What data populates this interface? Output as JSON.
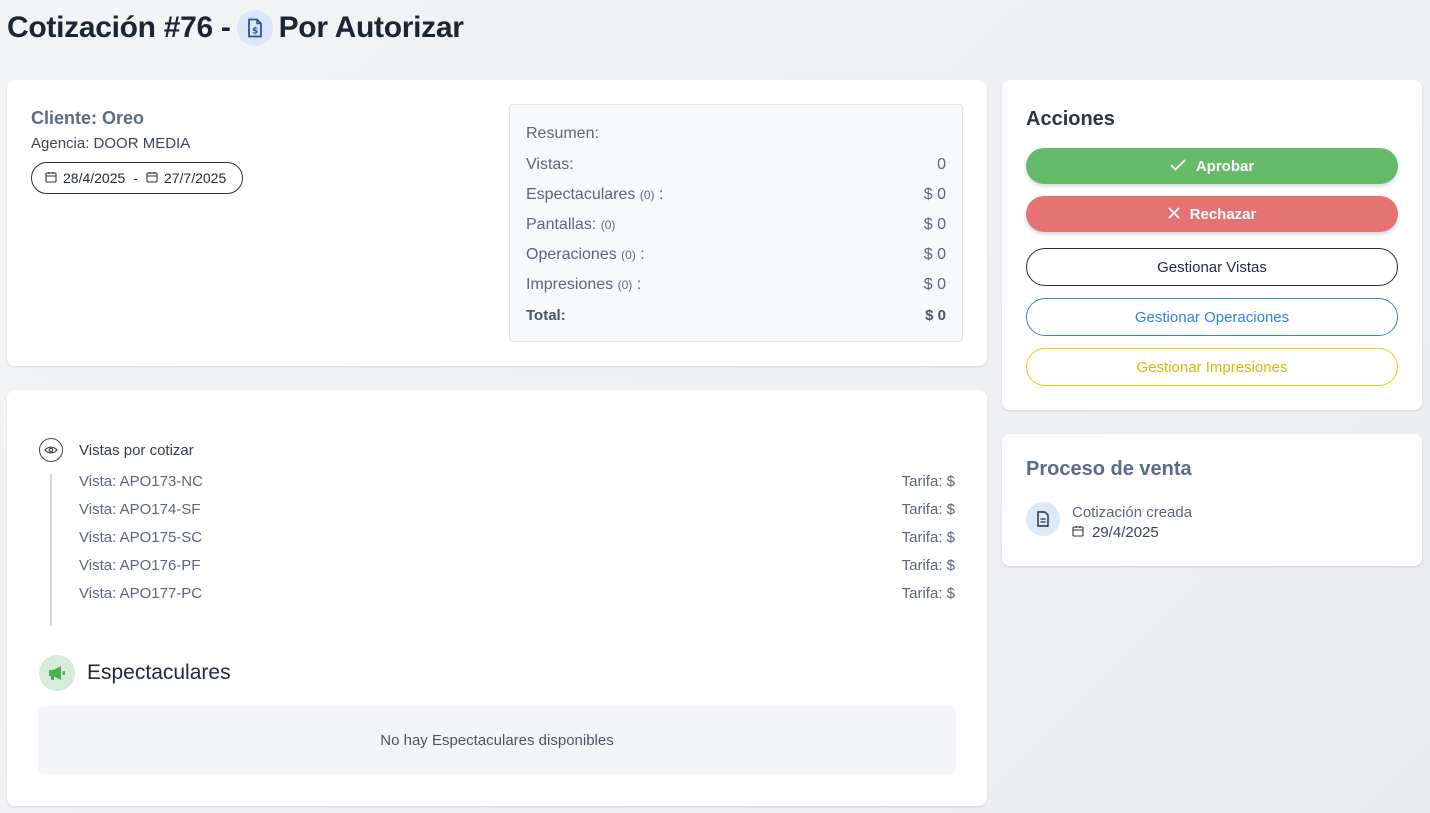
{
  "header": {
    "title_prefix": "Cotización #76 -",
    "status": "Por Autorizar",
    "status_icon": "dollar-document-icon"
  },
  "client": {
    "name": "Cliente: Oreo",
    "agency": "Agencia: DOOR MEDIA",
    "date_start": "28/4/2025",
    "date_separator": "-",
    "date_end": "27/7/2025"
  },
  "summary": {
    "title": "Resumen:",
    "rows": [
      {
        "label": "Vistas:",
        "count": "",
        "suffix": "",
        "value": "0"
      },
      {
        "label": "Espectaculares",
        "count": "(0)",
        "suffix": ":",
        "value": "$ 0"
      },
      {
        "label": "Pantallas:",
        "count": "(0)",
        "suffix": "",
        "value": "$ 0"
      },
      {
        "label": "Operaciones",
        "count": "(0)",
        "suffix": ":",
        "value": "$ 0"
      },
      {
        "label": "Impresiones",
        "count": "(0)",
        "suffix": ":",
        "value": "$ 0"
      }
    ],
    "total_label": "Total:",
    "total_value": "$ 0"
  },
  "views": {
    "title": "Vistas por cotizar",
    "items": [
      {
        "name": "Vista: APO173-NC",
        "rate": "Tarifa: $"
      },
      {
        "name": "Vista: APO174-SF",
        "rate": "Tarifa: $"
      },
      {
        "name": "Vista: APO175-SC",
        "rate": "Tarifa: $"
      },
      {
        "name": "Vista: APO176-PF",
        "rate": "Tarifa: $"
      },
      {
        "name": "Vista: APO177-PC",
        "rate": "Tarifa: $"
      }
    ]
  },
  "espectaculares": {
    "title": "Espectaculares",
    "empty_text": "No hay Espectaculares disponibles",
    "icon": "megaphone-icon"
  },
  "actions": {
    "title": "Acciones",
    "approve": "Aprobar",
    "reject": "Rechazar",
    "manage_views": "Gestionar Vistas",
    "manage_ops": "Gestionar Operaciones",
    "manage_prints": "Gestionar Impresiones"
  },
  "process": {
    "title": "Proceso de venta",
    "step_label": "Cotización creada",
    "step_date": "29/4/2025"
  },
  "colors": {
    "approve": "#66bb6a",
    "reject": "#e57373",
    "ops": "#2e86de",
    "prints": "#f5c518",
    "espectaculares_icon": "#4caf50"
  }
}
